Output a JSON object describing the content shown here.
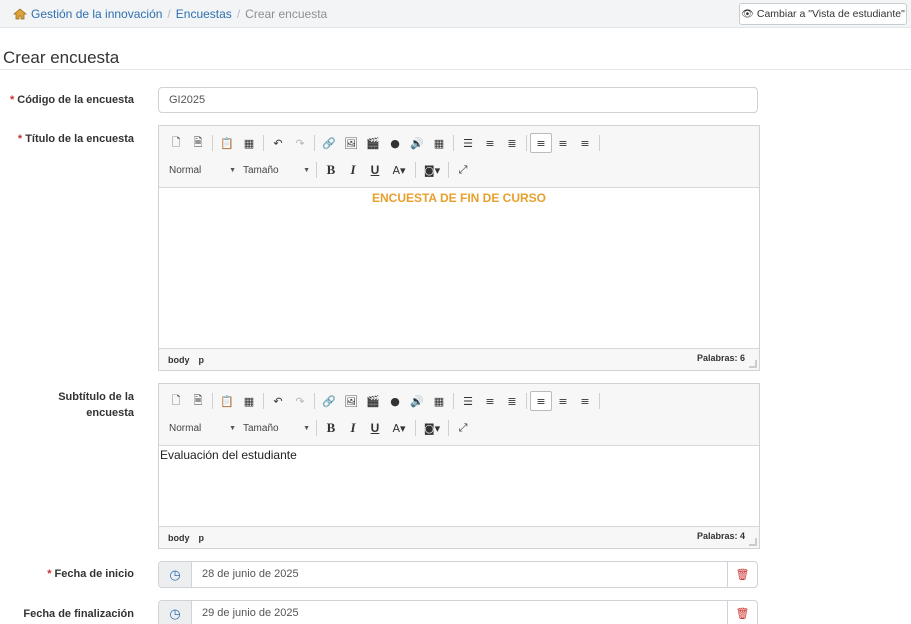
{
  "breadcrumb": {
    "items": [
      "Gestión de la innovación",
      "Encuestas"
    ],
    "current": "Crear encuesta",
    "separator": "/"
  },
  "header": {
    "student_view_button": "Cambiar a \"Vista de estudiante\""
  },
  "page": {
    "title": "Crear encuesta"
  },
  "form": {
    "required_mark": "*",
    "code": {
      "label": "Código de la encuesta",
      "value": "GI2025"
    },
    "title": {
      "label": "Título de la encuesta",
      "content": "ENCUESTA DE FIN DE CURSO",
      "content_color": "#e8a02c",
      "path": [
        "body",
        "p"
      ],
      "word_count": "Palabras: 6"
    },
    "subtitle": {
      "label_line1": "Subtítulo de la",
      "label_line2": "encuesta",
      "content": "Evaluación del estudiante",
      "path": [
        "body",
        "p"
      ],
      "word_count": "Palabras: 4"
    },
    "start_date": {
      "label": "Fecha de inicio",
      "value": "28 de junio de 2025"
    },
    "end_date": {
      "label": "Fecha de finalización",
      "value": "29 de junio de 2025"
    }
  },
  "editor_toolbar": {
    "format_combo": "Normal",
    "size_combo": "Tamaño"
  },
  "colors": {
    "link": "#2e6fb0",
    "required": "#c9302c",
    "accent_title": "#e8a02c"
  }
}
